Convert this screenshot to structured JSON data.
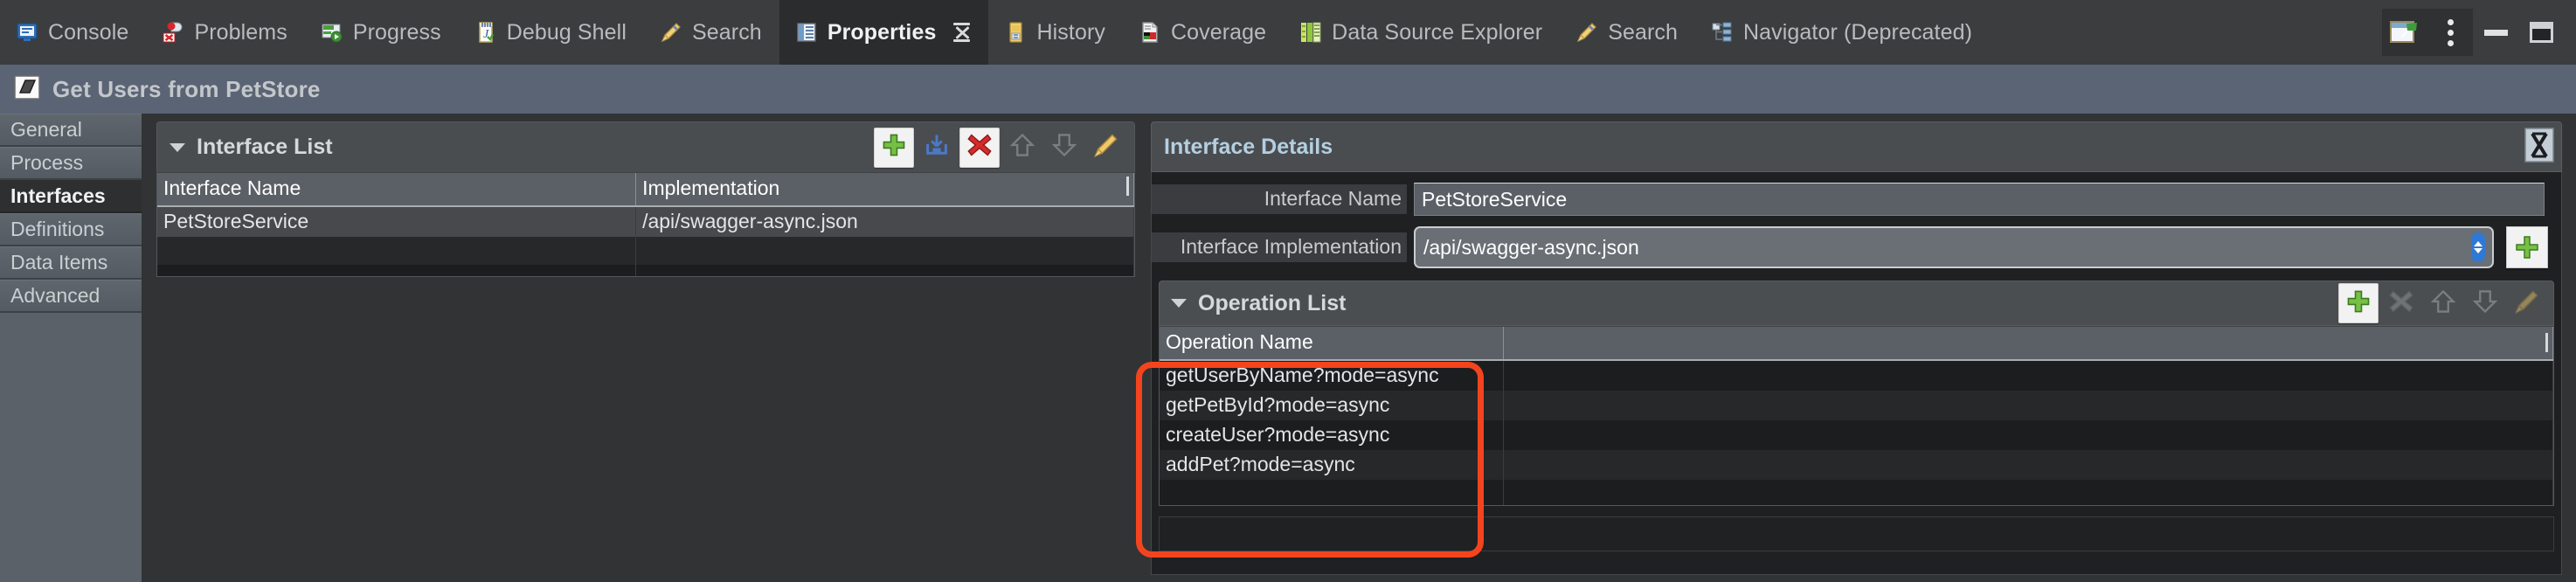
{
  "tabbar": {
    "tabs": [
      {
        "label": "Console",
        "icon": "console-icon",
        "active": false,
        "closable": false
      },
      {
        "label": "Problems",
        "icon": "problems-icon",
        "active": false,
        "closable": false
      },
      {
        "label": "Progress",
        "icon": "progress-icon",
        "active": false,
        "closable": false
      },
      {
        "label": "Debug Shell",
        "icon": "debug-shell-icon",
        "active": false,
        "closable": false
      },
      {
        "label": "Search",
        "icon": "search-pencil-icon",
        "active": false,
        "closable": false
      },
      {
        "label": "Properties",
        "icon": "properties-icon",
        "active": true,
        "closable": true
      },
      {
        "label": "History",
        "icon": "history-icon",
        "active": false,
        "closable": false
      },
      {
        "label": "Coverage",
        "icon": "coverage-icon",
        "active": false,
        "closable": false
      },
      {
        "label": "Data Source Explorer",
        "icon": "data-source-explorer-icon",
        "active": false,
        "closable": false
      },
      {
        "label": "Search",
        "icon": "search-pencil-icon",
        "active": false,
        "closable": false
      },
      {
        "label": "Navigator (Deprecated)",
        "icon": "navigator-icon",
        "active": false,
        "closable": false
      }
    ],
    "controls": [
      {
        "name": "pin-view-icon"
      },
      {
        "name": "view-menu-icon"
      },
      {
        "name": "minimize-icon"
      },
      {
        "name": "maximize-icon"
      }
    ]
  },
  "editor": {
    "title": "Get Users from PetStore",
    "icon": "diagram-icon"
  },
  "navrail": {
    "items": [
      {
        "label": "General",
        "active": false
      },
      {
        "label": "Process",
        "active": false
      },
      {
        "label": "Interfaces",
        "active": true
      },
      {
        "label": "Definitions",
        "active": false
      },
      {
        "label": "Data Items",
        "active": false
      },
      {
        "label": "Advanced",
        "active": false
      }
    ]
  },
  "interface_list": {
    "title": "Interface List",
    "tools": [
      {
        "name": "add-interface-button",
        "icon": "plus-green-icon",
        "enabled": true,
        "raised": true
      },
      {
        "name": "import-interface-button",
        "icon": "import-tray-icon",
        "enabled": true,
        "raised": false
      },
      {
        "name": "delete-interface-button",
        "icon": "delete-red-x-icon",
        "enabled": true,
        "raised": true
      },
      {
        "name": "move-up-button",
        "icon": "arrow-up-icon",
        "enabled": false,
        "raised": false
      },
      {
        "name": "move-down-button",
        "icon": "arrow-down-icon",
        "enabled": false,
        "raised": false
      },
      {
        "name": "edit-interface-button",
        "icon": "pencil-icon",
        "enabled": true,
        "raised": false
      }
    ],
    "columns": [
      "Interface Name",
      "Implementation"
    ],
    "rows": [
      {
        "name": "PetStoreService",
        "implementation": "/api/swagger-async.json",
        "selected": true
      },
      {
        "name": "",
        "implementation": "",
        "selected": false
      },
      {
        "name": "",
        "implementation": "",
        "selected": false
      }
    ]
  },
  "interface_details": {
    "title": "Interface Details",
    "close_icon": "maximize-restore-icon",
    "fields": {
      "interface_name": {
        "label": "Interface Name",
        "value": "PetStoreService"
      },
      "interface_implementation": {
        "label": "Interface Implementation",
        "value": "/api/swagger-async.json",
        "add_button_icon": "plus-green-icon"
      }
    },
    "operation_list": {
      "title": "Operation List",
      "tools": [
        {
          "name": "add-operation-button",
          "icon": "plus-green-icon",
          "enabled": true,
          "raised": true
        },
        {
          "name": "delete-operation-button",
          "icon": "delete-x-icon",
          "enabled": false,
          "raised": false
        },
        {
          "name": "operation-move-up-button",
          "icon": "arrow-up-icon",
          "enabled": false,
          "raised": false
        },
        {
          "name": "operation-move-down-button",
          "icon": "arrow-down-icon",
          "enabled": false,
          "raised": false
        },
        {
          "name": "edit-operation-button",
          "icon": "pencil-icon",
          "enabled": false,
          "raised": false
        }
      ],
      "columns": [
        "Operation Name",
        ""
      ],
      "rows": [
        {
          "name": "getUserByName?mode=async"
        },
        {
          "name": "getPetById?mode=async"
        },
        {
          "name": "createUser?mode=async"
        },
        {
          "name": "addPet?mode=async"
        },
        {
          "name": ""
        },
        {
          "name": ""
        }
      ]
    }
  },
  "annotation": {
    "color": "#f4441e",
    "target": "operation-name-column"
  }
}
